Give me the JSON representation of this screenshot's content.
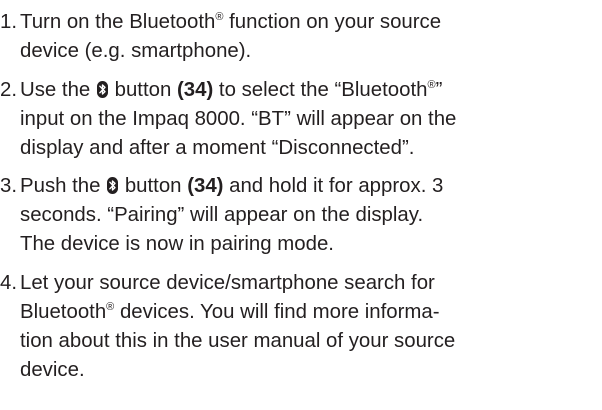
{
  "steps": [
    {
      "number": "1.",
      "lines": [
        [
          "Turn on the Bluetooth",
          "®",
          " function on your source"
        ],
        [
          "device (e.g. smartphone)."
        ]
      ]
    },
    {
      "number": "2.",
      "line1": {
        "a": "Use the ",
        "b": " button ",
        "c": "(34)",
        "d": " to select the “Bluetooth",
        "e": "®",
        "f": "”"
      },
      "line2": "input on the Impaq 8000. “BT” will appear on the",
      "line3": "display and after a moment “Disconnected”."
    },
    {
      "number": "3.",
      "line1": {
        "a": "Push the ",
        "b": " button ",
        "c": "(34)",
        "d": " and hold it for approx. 3"
      },
      "line2": "seconds. “Pairing” will appear on the display.",
      "line3": "The device is now in pairing mode."
    },
    {
      "number": "4.",
      "line1": "Let your source device/smartphone search for",
      "line2": {
        "a": "Bluetooth",
        "b": "®",
        "c": " devices. You will find more informa-"
      },
      "line3": "tion about this in the user manual of your source",
      "line4": "device."
    }
  ],
  "icons": {
    "bluetooth": "bluetooth-icon"
  },
  "colors": {
    "text": "#231f20",
    "background": "#ffffff"
  }
}
